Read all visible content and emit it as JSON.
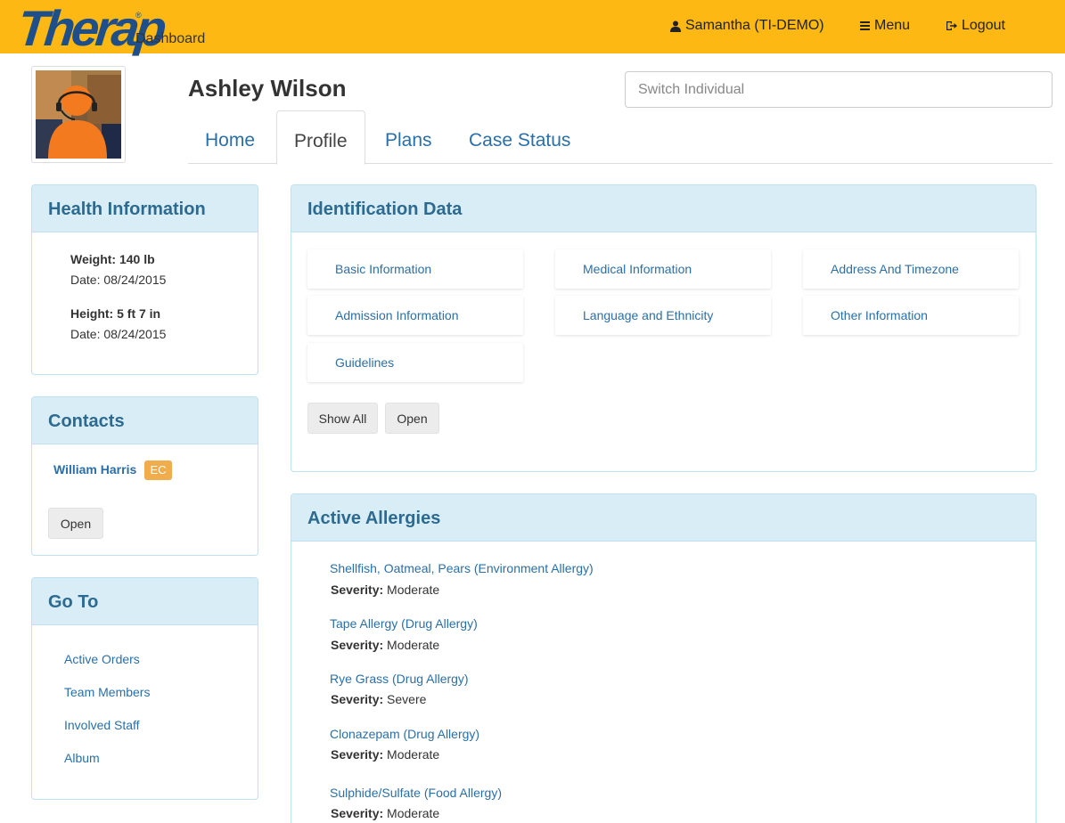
{
  "header": {
    "logo_text": "Therap",
    "logo_reg": "®",
    "section": "Dashboard",
    "user": "Samantha (TI-DEMO)",
    "menu": "Menu",
    "logout": "Logout",
    "accent_color": "#fdb813",
    "logo_color": "#1e4f8a"
  },
  "individual": {
    "name": "Ashley Wilson",
    "switch_placeholder": "Switch Individual"
  },
  "tabs": [
    {
      "label": "Home",
      "active": false
    },
    {
      "label": "Profile",
      "active": true
    },
    {
      "label": "Plans",
      "active": false
    },
    {
      "label": "Case Status",
      "active": false
    }
  ],
  "health": {
    "title": "Health Information",
    "weight_label": "Weight: 140 lb",
    "weight_date": "Date: 08/24/2015",
    "height_label": "Height: 5 ft 7 in",
    "height_date": "Date: 08/24/2015"
  },
  "contacts": {
    "title": "Contacts",
    "items": [
      {
        "name": "William Harris",
        "badge": "EC"
      }
    ],
    "open_label": "Open"
  },
  "goto": {
    "title": "Go To",
    "links": [
      "Active Orders",
      "Team Members",
      "Involved Staff",
      "Album"
    ]
  },
  "identification": {
    "title": "Identification Data",
    "cards": [
      "Basic Information",
      "Medical Information",
      "Address And Timezone",
      "Admission Information",
      "Language and Ethnicity",
      "Other Information",
      "Guidelines"
    ],
    "show_all_label": "Show All",
    "open_label": "Open"
  },
  "allergies": {
    "title": "Active Allergies",
    "severity_label": "Severity:",
    "items": [
      {
        "name": "Shellfish, Oatmeal, Pears (Environment Allergy)",
        "severity": "Moderate"
      },
      {
        "name": "Tape Allergy (Drug Allergy)",
        "severity": "Moderate"
      },
      {
        "name": "Rye Grass (Drug Allergy)",
        "severity": "Severe"
      },
      {
        "name": "Clonazepam (Drug Allergy)",
        "severity": "Moderate"
      },
      {
        "name": "Sulphide/Sulfate (Food Allergy)",
        "severity": "Moderate"
      }
    ]
  }
}
